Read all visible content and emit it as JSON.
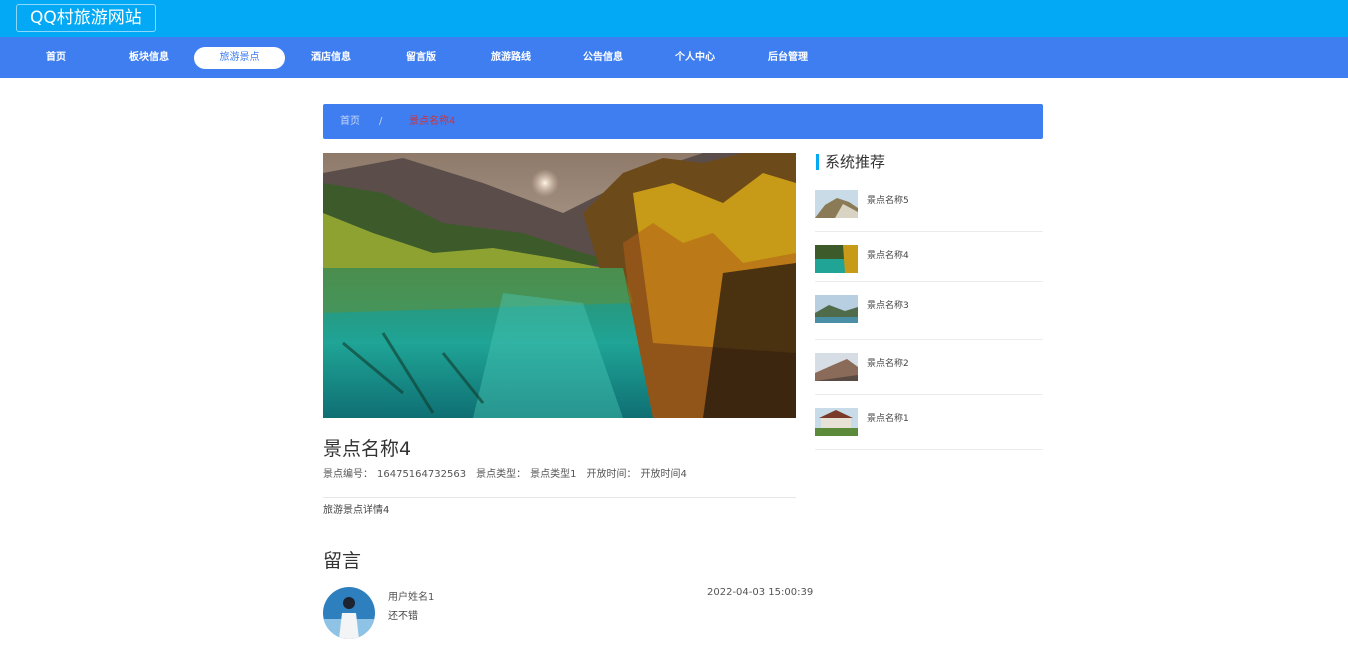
{
  "site": {
    "title": "QQ村旅游网站"
  },
  "nav": [
    {
      "label": "首页",
      "active": false
    },
    {
      "label": "板块信息",
      "active": false
    },
    {
      "label": "旅游景点",
      "active": true
    },
    {
      "label": "酒店信息",
      "active": false
    },
    {
      "label": "留言版",
      "active": false
    },
    {
      "label": "旅游路线",
      "active": false
    },
    {
      "label": "公告信息",
      "active": false
    },
    {
      "label": "个人中心",
      "active": false
    },
    {
      "label": "后台管理",
      "active": false
    }
  ],
  "breadcrumb": {
    "home": "首页",
    "separator": "/",
    "current": "景点名称4"
  },
  "spot": {
    "name": "景点名称4",
    "id_label": "景点编号：",
    "id_value": "16475164732563",
    "type_label": "景点类型：",
    "type_value": "景点类型1",
    "hours_label": "开放时间：",
    "hours_value": "开放时间4",
    "detail": "旅游景点详情4"
  },
  "comments": {
    "title": "留言",
    "items": [
      {
        "user": "用户姓名1",
        "text": "还不错",
        "time": "2022-04-03 15:00:39"
      }
    ]
  },
  "sidebar": {
    "title": "系统推荐",
    "items": [
      {
        "label": "景点名称5"
      },
      {
        "label": "景点名称4"
      },
      {
        "label": "景点名称3"
      },
      {
        "label": "景点名称2"
      },
      {
        "label": "景点名称1"
      }
    ]
  },
  "colors": {
    "topbar": "#03a9f4",
    "nav": "#3f7ef0",
    "breadcrumb_current": "#d0323b"
  }
}
